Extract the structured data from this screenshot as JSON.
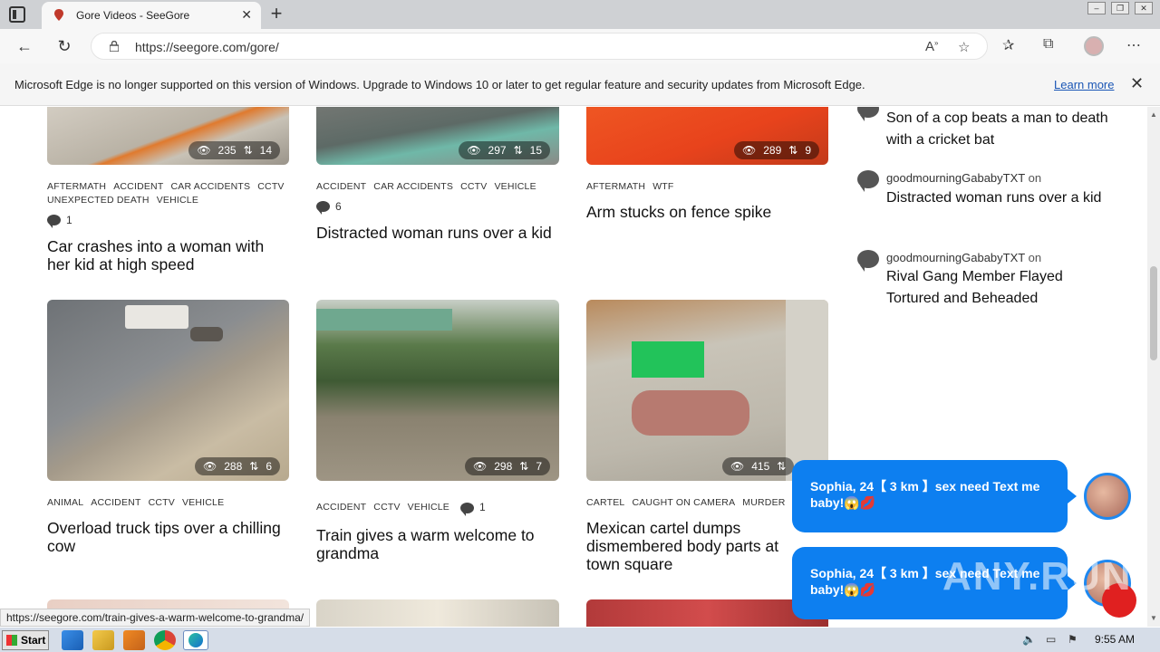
{
  "browser": {
    "tab_title": "Gore Videos - SeeGore",
    "url": "https://seegore.com/gore/",
    "url_host": "seegore.com",
    "status_url": "https://seegore.com/train-gives-a-warm-welcome-to-grandma/"
  },
  "infobar": {
    "message": "Microsoft Edge is no longer supported on this version of Windows. Upgrade to Windows 10 or later to get regular feature and security updates from Microsoft Edge.",
    "link": "Learn more"
  },
  "posts": [
    {
      "views": "235",
      "shares": "14",
      "tags": [
        "AFTERMATH",
        "ACCIDENT",
        "CAR ACCIDENTS",
        "CCTV",
        "UNEXPECTED DEATH",
        "VEHICLE"
      ],
      "comments": "1",
      "title": "Car crashes into a woman with her kid at high speed"
    },
    {
      "views": "297",
      "shares": "15",
      "tags": [
        "ACCIDENT",
        "CAR ACCIDENTS",
        "CCTV",
        "VEHICLE"
      ],
      "comments": "6",
      "title": "Distracted woman runs over a kid"
    },
    {
      "views": "289",
      "shares": "9",
      "tags": [
        "AFTERMATH",
        "WTF"
      ],
      "comments": "",
      "title": "Arm stucks on fence spike"
    },
    {
      "views": "288",
      "shares": "6",
      "tags": [
        "ANIMAL",
        "ACCIDENT",
        "CCTV",
        "VEHICLE"
      ],
      "comments": "",
      "title": "Overload truck tips over a chilling cow"
    },
    {
      "views": "298",
      "shares": "7",
      "tags": [
        "ACCIDENT",
        "CCTV",
        "VEHICLE"
      ],
      "comments": "1",
      "title": "Train gives a warm welcome to grandma"
    },
    {
      "views": "415",
      "shares": "",
      "tags": [
        "CARTEL",
        "CAUGHT ON CAMERA",
        "MURDER",
        "W"
      ],
      "comments": "",
      "title": "Mexican cartel dumps dismembered body parts at town square"
    }
  ],
  "sidebar": {
    "on_word": "on",
    "items": [
      {
        "user": "",
        "title": "Son of a cop beats a man to death with a cricket bat"
      },
      {
        "user": "goodmourningGababyTXT",
        "title": "Distracted woman runs over a kid"
      },
      {
        "user": "goodmourningGababyTXT",
        "title": "Rival Gang Member Flayed Tortured and Beheaded"
      }
    ]
  },
  "chat": {
    "messages": [
      "Sophia, 24【 3 km 】sex need Text me baby!😱💋",
      "Sophia, 24【 3 km 】sex need Text me baby!😱💋"
    ]
  },
  "watermark": "ANY.RUN",
  "taskbar": {
    "start": "Start",
    "clock": "9:55 AM"
  },
  "colors": {
    "accent": "#0d7ff0",
    "link": "#1a56b5"
  }
}
